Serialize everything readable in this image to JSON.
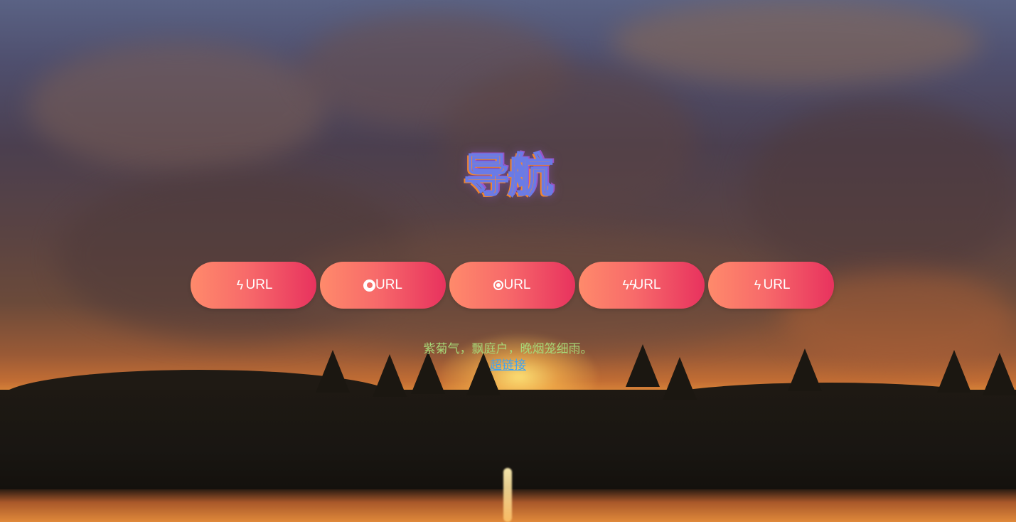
{
  "header": {
    "title": "导航"
  },
  "nav": {
    "buttons": [
      {
        "icon": "lightning-bolt-icon",
        "label": "URL"
      },
      {
        "icon": "firefox-icon",
        "label": "URL"
      },
      {
        "icon": "chrome-icon",
        "label": "URL"
      },
      {
        "icon": "double-lightning-icon",
        "label": "URL"
      },
      {
        "icon": "lightning-bolt-icon",
        "label": "URL"
      }
    ]
  },
  "content": {
    "poem": "紫菊气，飘庭户，晚烟笼细雨。",
    "link_label": "超链接"
  },
  "colors": {
    "button_gradient_start": "#ff8a6b",
    "button_gradient_end": "#e8325e",
    "poem_color": "#a7d878",
    "link_color": "#3fa2f2"
  }
}
